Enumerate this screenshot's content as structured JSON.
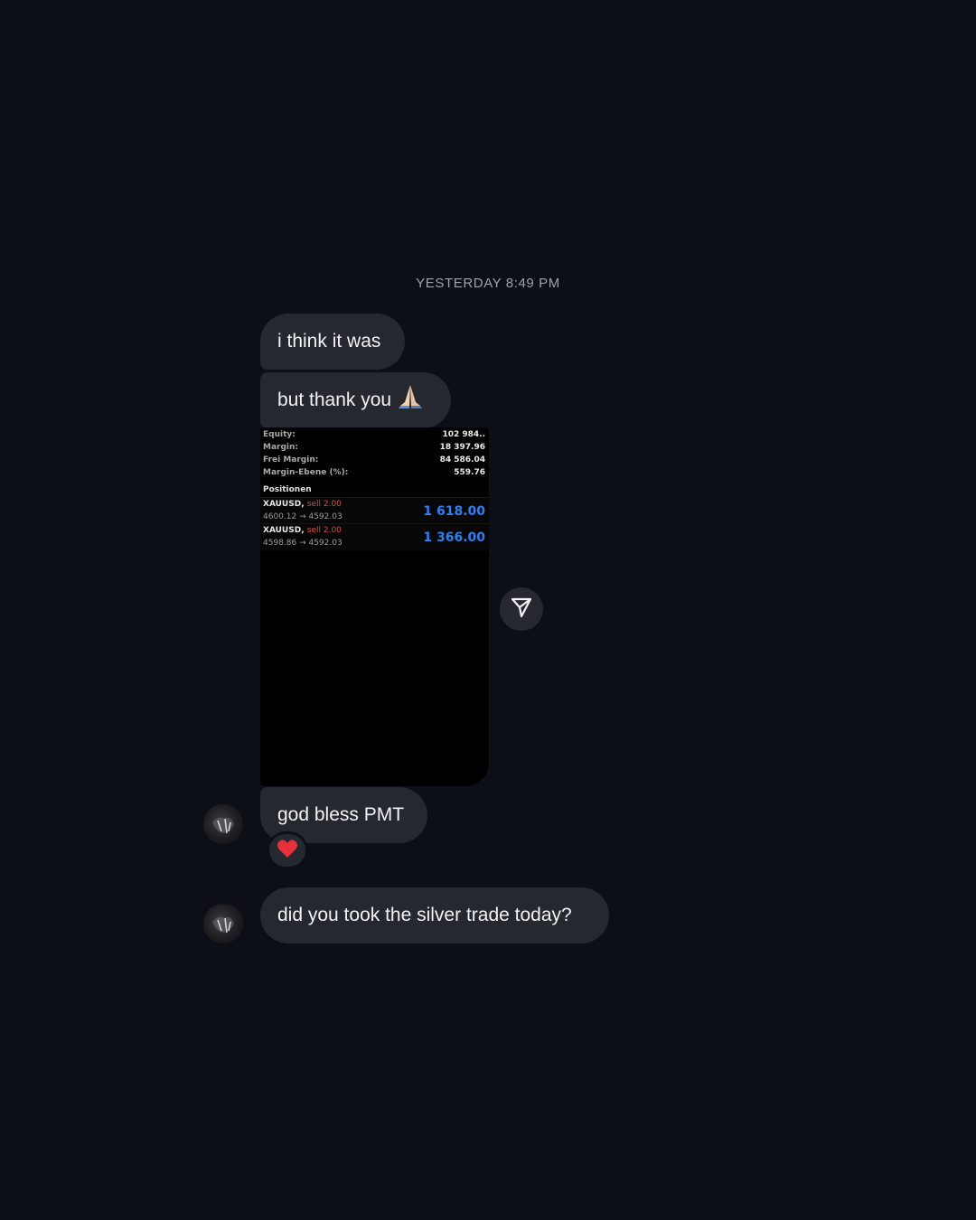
{
  "timestamp": "YESTERDAY 8:49 PM",
  "messages": [
    {
      "text": "i think it was"
    },
    {
      "text": "but thank you",
      "emoji": "folded-hands"
    },
    {
      "text": "god bless PMT",
      "reaction": "heart"
    },
    {
      "text": "did you took the silver trade today?"
    }
  ],
  "screenshot": {
    "account": [
      {
        "label": "Equity:",
        "value": "102 984.."
      },
      {
        "label": "Margin:",
        "value": "18 397.96"
      },
      {
        "label": "Frei Margin:",
        "value": "84 586.04"
      },
      {
        "label": "Margin-Ebene (%):",
        "value": "559.76"
      }
    ],
    "positions_label": "Positionen",
    "positions": [
      {
        "symbol": "XAUUSD,",
        "side": "sell 2.00",
        "prices": "4600.12 → 4592.03",
        "pnl": "1 618.00"
      },
      {
        "symbol": "XAUUSD,",
        "side": "sell 2.00",
        "prices": "4598.86 → 4592.03",
        "pnl": "1 366.00"
      }
    ]
  },
  "icons": {
    "share": "paper-plane-icon",
    "reaction": "heart-icon",
    "emoji": "folded-hands-icon"
  },
  "colors": {
    "background": "#0c0f15",
    "bubble": "#25282f",
    "pnl_blue": "#2f7ff0",
    "sell_red": "#e0483c"
  }
}
